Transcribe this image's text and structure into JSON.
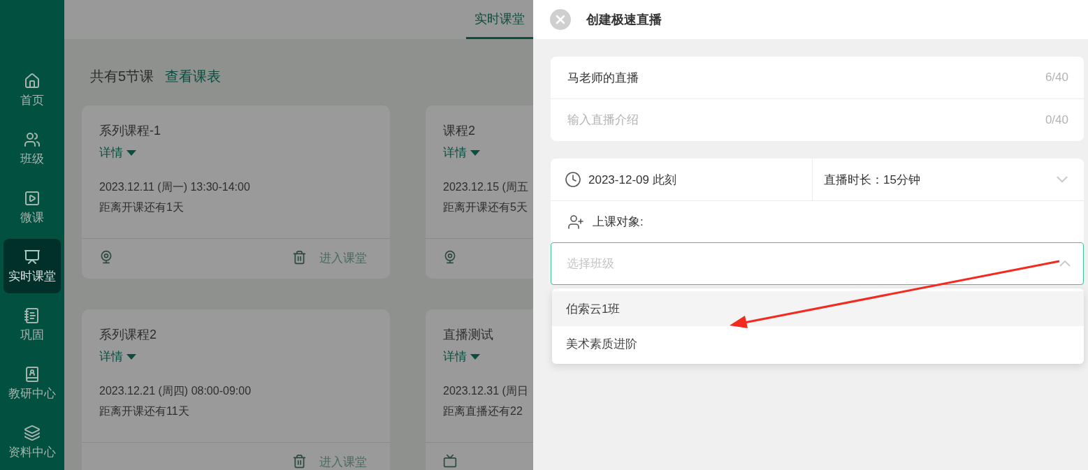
{
  "sidebar": {
    "items": [
      {
        "label": "首页",
        "selected": false
      },
      {
        "label": "班级",
        "selected": false
      },
      {
        "label": "微课",
        "selected": false
      },
      {
        "label": "实时课堂",
        "selected": true
      },
      {
        "label": "巩固",
        "selected": false
      },
      {
        "label": "教研中心",
        "selected": false
      },
      {
        "label": "资料中心",
        "selected": false
      }
    ]
  },
  "header": {
    "tabs": [
      {
        "label": "实时课堂",
        "selected": true
      }
    ]
  },
  "summary": {
    "count": "共有5节课",
    "schedule_link": "查看课表"
  },
  "courses": [
    {
      "title": "系列课程-1",
      "details": "详情",
      "time": "2023.12.11 (周一) 13:30-14:00",
      "countdown": "距离开课还有1天",
      "kind": "webcam",
      "enter": "进入课堂",
      "disabled": true
    },
    {
      "title": "课程2",
      "details": "详情",
      "time": "2023.12.15 (周五",
      "countdown": "距离开课还有5天",
      "kind": "webcam"
    },
    {
      "title": "系列课程2",
      "details": "详情",
      "time": "2023.12.21 (周四) 08:00-09:00",
      "countdown": "距离开课还有11天",
      "kind": "plain",
      "enter": "进入课堂",
      "disabled": true
    },
    {
      "title": "直播测试",
      "details": "详情",
      "time": "2023.12.31 (周日",
      "countdown": "距离直播还有22",
      "kind": "tv"
    }
  ],
  "drawer": {
    "title": "创建极速直播",
    "fields": [
      {
        "value": "马老师的直播",
        "counter": "6/40"
      },
      {
        "placeholder": "输入直播介绍",
        "counter": "0/40"
      }
    ],
    "start": "2023-12-09 此刻",
    "duration": "直播时长：15分钟",
    "audience_label": "上课对象:",
    "class_select": {
      "placeholder": "选择班级",
      "expanded": true,
      "options": [
        {
          "label": "伯索云1班",
          "selected": true
        },
        {
          "label": "美术素质进阶",
          "selected": false
        }
      ]
    }
  }
}
